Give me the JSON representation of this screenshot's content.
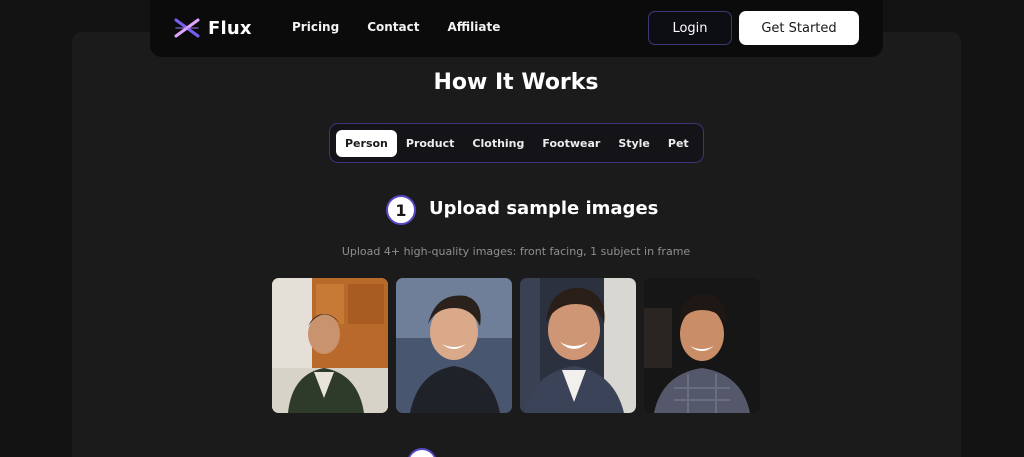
{
  "brand": {
    "name": "Flux"
  },
  "nav": {
    "links": [
      "Pricing",
      "Contact",
      "Affiliate"
    ],
    "login_label": "Login",
    "cta_label": "Get Started"
  },
  "section": {
    "title": "How It Works"
  },
  "tabs": [
    "Person",
    "Product",
    "Clothing",
    "Footwear",
    "Style",
    "Pet"
  ],
  "active_tab": "Person",
  "step1": {
    "number": "1",
    "title": "Upload sample images",
    "description": "Upload 4+ high-quality images: front facing, 1 subject in frame"
  },
  "photos": [
    "sample-photo-1",
    "sample-photo-2",
    "sample-photo-3",
    "sample-photo-4"
  ],
  "colors": {
    "accent": "#5448c0",
    "background": "#131313",
    "card": "#1b1b1c"
  }
}
